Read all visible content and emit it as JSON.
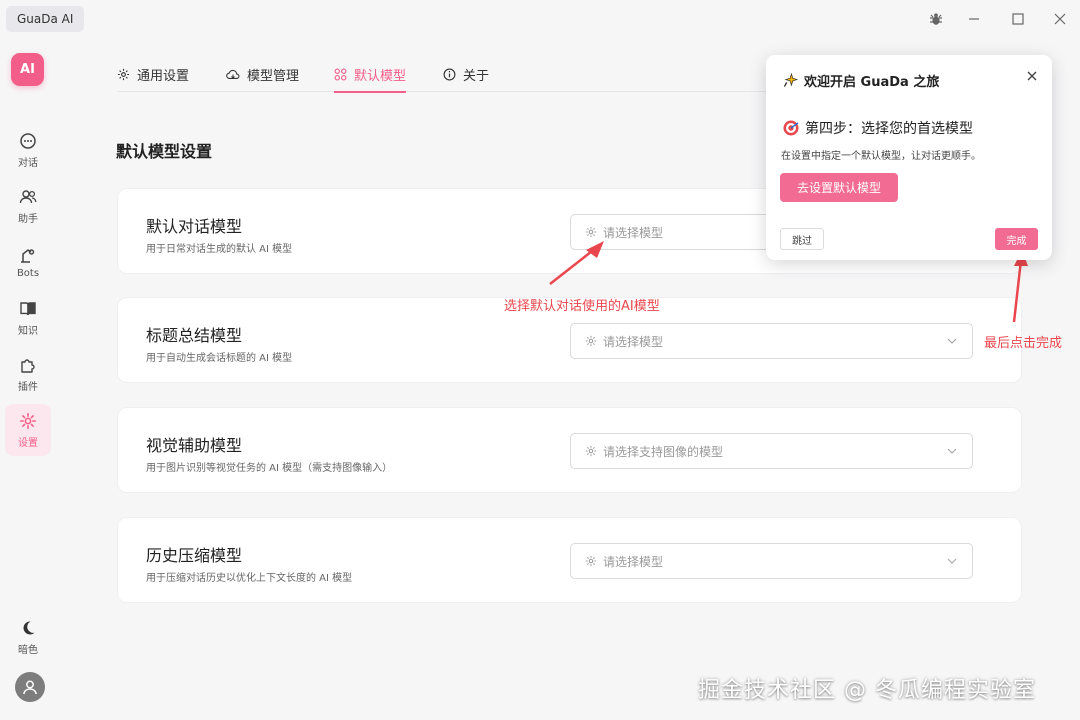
{
  "app": {
    "title": "GuaDa AI",
    "logo_text": "AI"
  },
  "sidebar": {
    "items": [
      {
        "label": "对话",
        "icon": "chat-icon"
      },
      {
        "label": "助手",
        "icon": "users-icon"
      },
      {
        "label": "Bots",
        "icon": "bot-icon"
      },
      {
        "label": "知识",
        "icon": "book-icon"
      },
      {
        "label": "插件",
        "icon": "puzzle-icon"
      },
      {
        "label": "设置",
        "icon": "settings-icon",
        "active": true
      }
    ],
    "theme_label": "暗色"
  },
  "tabs": [
    {
      "label": "通用设置"
    },
    {
      "label": "模型管理"
    },
    {
      "label": "默认模型",
      "active": true
    },
    {
      "label": "关于"
    }
  ],
  "section_title": "默认模型设置",
  "cards": [
    {
      "title": "默认对话模型",
      "desc": "用于日常对话生成的默认 AI 模型",
      "placeholder": "请选择模型"
    },
    {
      "title": "标题总结模型",
      "desc": "用于自动生成会话标题的 AI 模型",
      "placeholder": "请选择模型"
    },
    {
      "title": "视觉辅助模型",
      "desc": "用于图片识别等视觉任务的 AI 模型（需支持图像输入）",
      "placeholder": "请选择支持图像的模型"
    },
    {
      "title": "历史压缩模型",
      "desc": "用于压缩对话历史以优化上下文长度的 AI 模型",
      "placeholder": "请选择模型"
    }
  ],
  "popover": {
    "title": "欢迎开启 GuaDa 之旅",
    "step": "第四步：选择您的首选模型",
    "desc": "在设置中指定一个默认模型，让对话更顺手。",
    "primary_button": "去设置默认模型",
    "skip_button": "跳过",
    "done_button": "完成"
  },
  "annotations": {
    "select_hint": "选择默认对话使用的AI模型",
    "finish_hint": "最后点击完成"
  },
  "watermark": "掘金技术社区 @ 冬瓜编程实验室",
  "colors": {
    "accent": "#f25e89",
    "annotation": "#e9474d"
  }
}
